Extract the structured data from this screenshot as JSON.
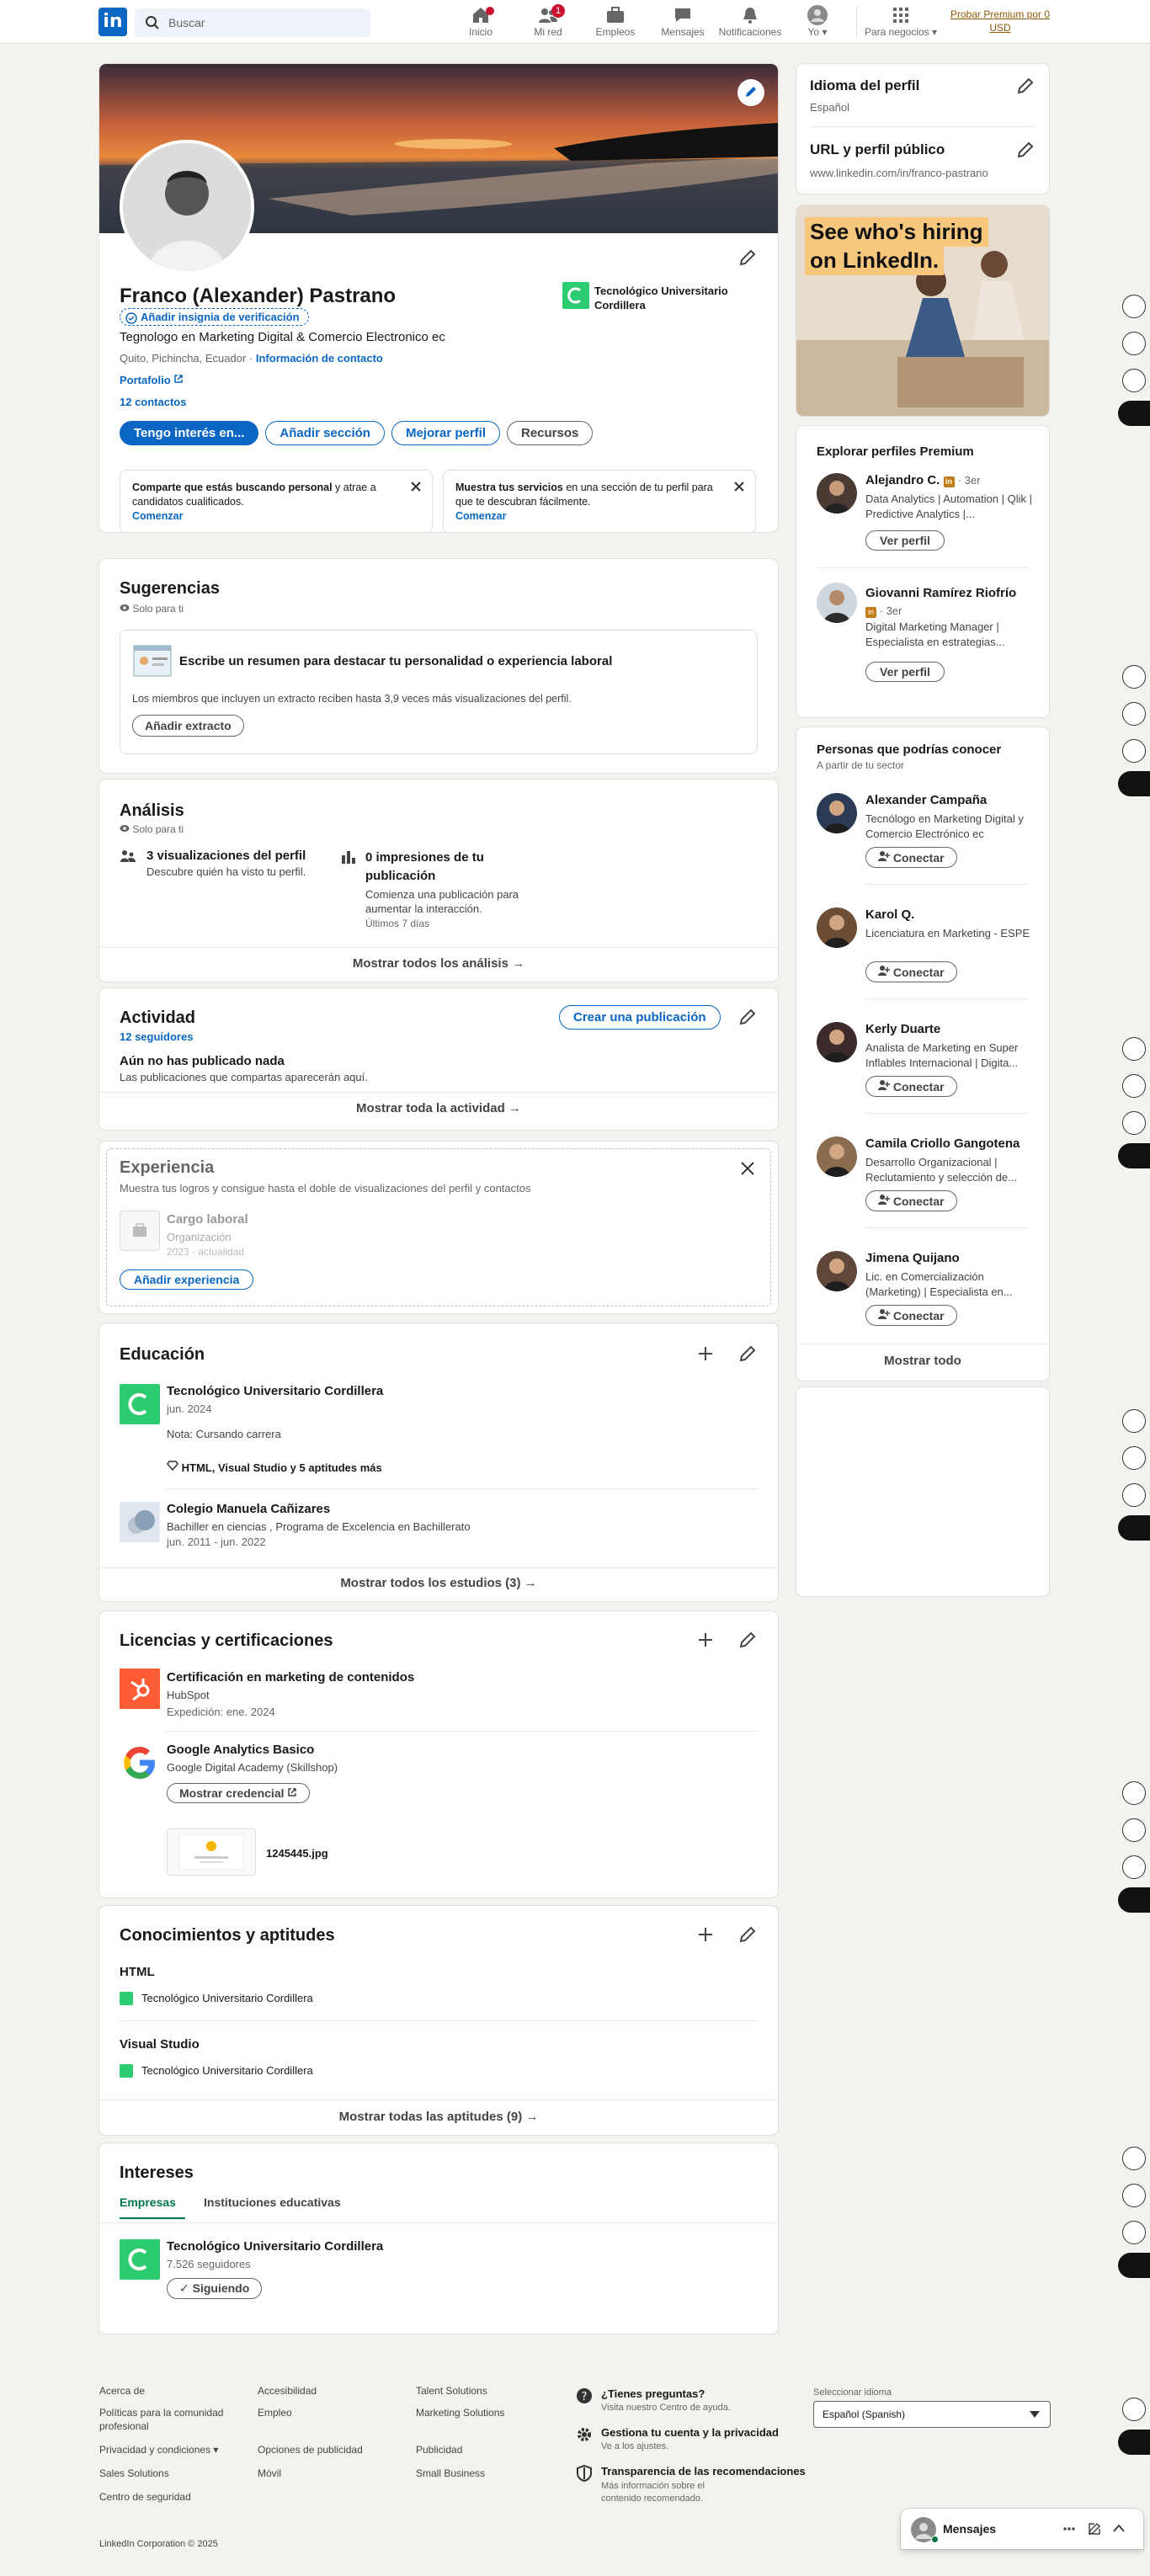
{
  "nav": {
    "search_placeholder": "Buscar",
    "items": [
      {
        "label": "Inicio",
        "badge": ""
      },
      {
        "label": "Mi red",
        "badge": "1"
      },
      {
        "label": "Empleos",
        "badge": ""
      },
      {
        "label": "Mensajes",
        "badge": ""
      },
      {
        "label": "Notificaciones",
        "badge": ""
      },
      {
        "label": "Yo ▾",
        "badge": ""
      },
      {
        "label": "Para negocios ▾",
        "badge": ""
      }
    ],
    "premium": "Probar Premium por 0 USD"
  },
  "profile": {
    "name": "Franco (Alexander) Pastrano",
    "verify": "Añadir insignia de verificación",
    "headline": "Tegnologo en Marketing Digital & Comercio Electronico ec",
    "location": "Quito, Pichincha, Ecuador",
    "contact_info": "Información de contacto",
    "portfolio": "Portafolio",
    "connections": "12 contactos",
    "education_short": "Tecnológico Universitario Cordillera",
    "buttons": [
      "Tengo interés en...",
      "Añadir sección",
      "Mejorar perfil",
      "Recursos"
    ],
    "prompt1_a": "Comparte que estás buscando personal",
    "prompt1_b": " y atrae a candidatos cualificados.",
    "prompt1_cta": "Comenzar",
    "prompt2_a": "Muestra tus servicios",
    "prompt2_b": " en una sección de tu perfil para que te descubran fácilmente.",
    "prompt2_cta": "Comenzar"
  },
  "suggestions": {
    "title": "Sugerencias",
    "private": "Solo para ti",
    "card_title": "Escribe un resumen para destacar tu personalidad o experiencia laboral",
    "card_text": "Los miembros que incluyen un extracto reciben hasta 3,9 veces más visualizaciones del perfil.",
    "button": "Añadir extracto"
  },
  "analytics": {
    "title": "Análisis",
    "private": "Solo para ti",
    "views_title": "3 visualizaciones del perfil",
    "views_sub": "Descubre quién ha visto tu perfil.",
    "impr_title": "0 impresiones de tu publicación",
    "impr_sub": "Comienza una publicación para aumentar la interacción.",
    "impr_period": "Últimos 7 días",
    "show_all": "Mostrar todos los análisis →"
  },
  "activity": {
    "title": "Actividad",
    "followers": "12 seguidores",
    "create": "Crear una publicación",
    "empty_title": "Aún no has publicado nada",
    "empty_sub": "Las publicaciones que compartas aparecerán aquí.",
    "show_all": "Mostrar toda la actividad →"
  },
  "experience": {
    "title": "Experiencia",
    "sub": "Muestra tus logros y consigue hasta el doble de visualizaciones del perfil y contactos",
    "role": "Cargo laboral",
    "org": "Organización",
    "dates": "2023 - actualidad",
    "button": "Añadir experiencia"
  },
  "education": {
    "title": "Educación",
    "items": [
      {
        "school": "Tecnológico Universitario Cordillera",
        "date": "jun. 2024",
        "note": "Nota: Cursando carrera",
        "skills": "HTML, Visual Studio y 5 aptitudes más"
      },
      {
        "school": "Colegio Manuela Cañizares",
        "degree": "Bachiller en ciencias , Programa de Excelencia en Bachillerato",
        "date": "jun. 2011 - jun. 2022"
      }
    ],
    "show_all": "Mostrar todos los estudios (3) →"
  },
  "licenses": {
    "title": "Licencias y certificaciones",
    "items": [
      {
        "name": "Certificación en marketing de contenidos",
        "issuer": "HubSpot",
        "date": "Expedición: ene. 2024"
      },
      {
        "name": "Google Analytics Basico",
        "issuer": "Google Digital Academy (Skillshop)",
        "button": "Mostrar credencial",
        "file": "1245445.jpg"
      }
    ]
  },
  "skills": {
    "title": "Conocimientos y aptitudes",
    "items": [
      {
        "name": "HTML",
        "org": "Tecnológico Universitario Cordillera"
      },
      {
        "name": "Visual Studio",
        "org": "Tecnológico Universitario Cordillera"
      }
    ],
    "show_all": "Mostrar todas las aptitudes (9) →"
  },
  "interests": {
    "title": "Intereses",
    "tabs": [
      "Empresas",
      "Instituciones educativas"
    ],
    "company": "Tecnológico Universitario Cordillera",
    "followers": "7.526 seguidores",
    "following": "✓ Siguiendo"
  },
  "sidebar": {
    "lang_title": "Idioma del perfil",
    "lang_value": "Español",
    "url_title": "URL y perfil público",
    "url_value": "www.linkedin.com/in/franco-pastrano",
    "ad_line1": "See who's hiring",
    "ad_line2": "on LinkedIn.",
    "premium_title": "Explorar perfiles Premium",
    "premium_people": [
      {
        "name": "Alejandro C.",
        "degree": "· 3er",
        "headline": "Data Analytics | Automation | Qlik | Predictive Analytics |...",
        "button": "Ver perfil"
      },
      {
        "name": "Giovanni Ramírez Riofrío",
        "degree": "· 3er",
        "headline": "Digital Marketing Manager | Especialista en estrategias...",
        "button": "Ver perfil"
      }
    ],
    "pymk_title": "Personas que podrías conocer",
    "pymk_sub": "A partir de tu sector",
    "pymk": [
      {
        "name": "Alexander Campaña",
        "headline": "Tecnólogo en Marketing Digital y Comercio Electrónico ec",
        "button": "Conectar"
      },
      {
        "name": "Karol Q.",
        "headline": "Licenciatura en Marketing - ESPE",
        "button": "Conectar"
      },
      {
        "name": "Kerly Duarte",
        "headline": "Analista de Marketing en Super Inflables Internacional | Digita...",
        "button": "Conectar"
      },
      {
        "name": "Camila Criollo Gangotena",
        "headline": "Desarrollo Organizacional | Reclutamiento y selección de...",
        "button": "Conectar"
      },
      {
        "name": "Jimena Quijano",
        "headline": "Lic. en Comercialización (Marketing) | Especialista en...",
        "button": "Conectar"
      }
    ],
    "pymk_show_all": "Mostrar todo"
  },
  "footer": {
    "col1": [
      "Acerca de",
      "Políticas para la comunidad profesional",
      "Privacidad y condiciones ▾",
      "Sales Solutions",
      "Centro de seguridad"
    ],
    "col2": [
      "Accesibilidad",
      "Empleo",
      "Opciones de publicidad",
      "Móvil"
    ],
    "col3": [
      "Talent Solutions",
      "Marketing Solutions",
      "Publicidad",
      "Small Business"
    ],
    "help_title": "¿Tienes preguntas?",
    "help_sub": "Visita nuestro Centro de ayuda.",
    "account_title": "Gestiona tu cuenta y la privacidad",
    "account_sub": "Ve a los ajustes.",
    "transp_title": "Transparencia de las recomendaciones",
    "transp_sub": "Más información sobre el contenido recomendado.",
    "lang_label": "Seleccionar idioma",
    "lang_value": "Español (Spanish)",
    "copyright": "LinkedIn Corporation © 2025"
  },
  "messaging": {
    "label": "Mensajes"
  },
  "colors": {
    "brand": "#0a66c2",
    "accent_green": "#2ecc71",
    "badge_red": "#cb112d",
    "premium_gold": "#915907"
  }
}
